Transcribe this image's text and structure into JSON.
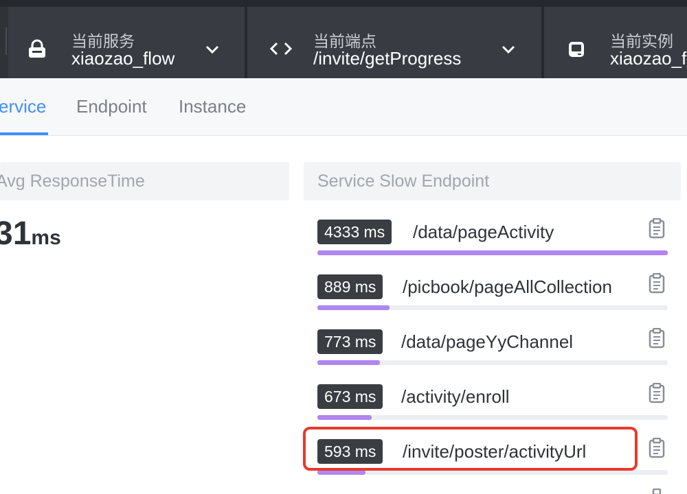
{
  "topbar": {
    "service": {
      "label": "当前服务",
      "value": "xiaozao_flow",
      "icon": "service-icon"
    },
    "endpoint": {
      "label": "当前端点",
      "value": "/invite/getProgress",
      "icon": "code-icon"
    },
    "instance": {
      "label": "当前实例",
      "value": "xiaozao_f",
      "icon": "instance-icon"
    }
  },
  "tabs": [
    {
      "label": "ervice",
      "active": true
    },
    {
      "label": "Endpoint",
      "active": false
    },
    {
      "label": "Instance",
      "active": false
    }
  ],
  "avg_panel": {
    "title": "Avg ResponseTime",
    "value": "31",
    "unit": "ms"
  },
  "slow_panel": {
    "title": "Service Slow Endpoint",
    "items": [
      {
        "time": "4333 ms",
        "path": "/data/pageActivity",
        "ratio": 1.0
      },
      {
        "time": "889 ms",
        "path": "/picbook/pageAllCollection",
        "ratio": 0.205
      },
      {
        "time": "773 ms",
        "path": "/data/pageYyChannel",
        "ratio": 0.178
      },
      {
        "time": "673 ms",
        "path": "/activity/enroll",
        "ratio": 0.155
      },
      {
        "time": "593 ms",
        "path": "/invite/poster/activityUrl",
        "ratio": 0.137
      }
    ]
  },
  "colors": {
    "accent": "#448dfe",
    "bar": "#b086f0",
    "highlight": "#e8392b",
    "topbar": "#2f3237"
  }
}
